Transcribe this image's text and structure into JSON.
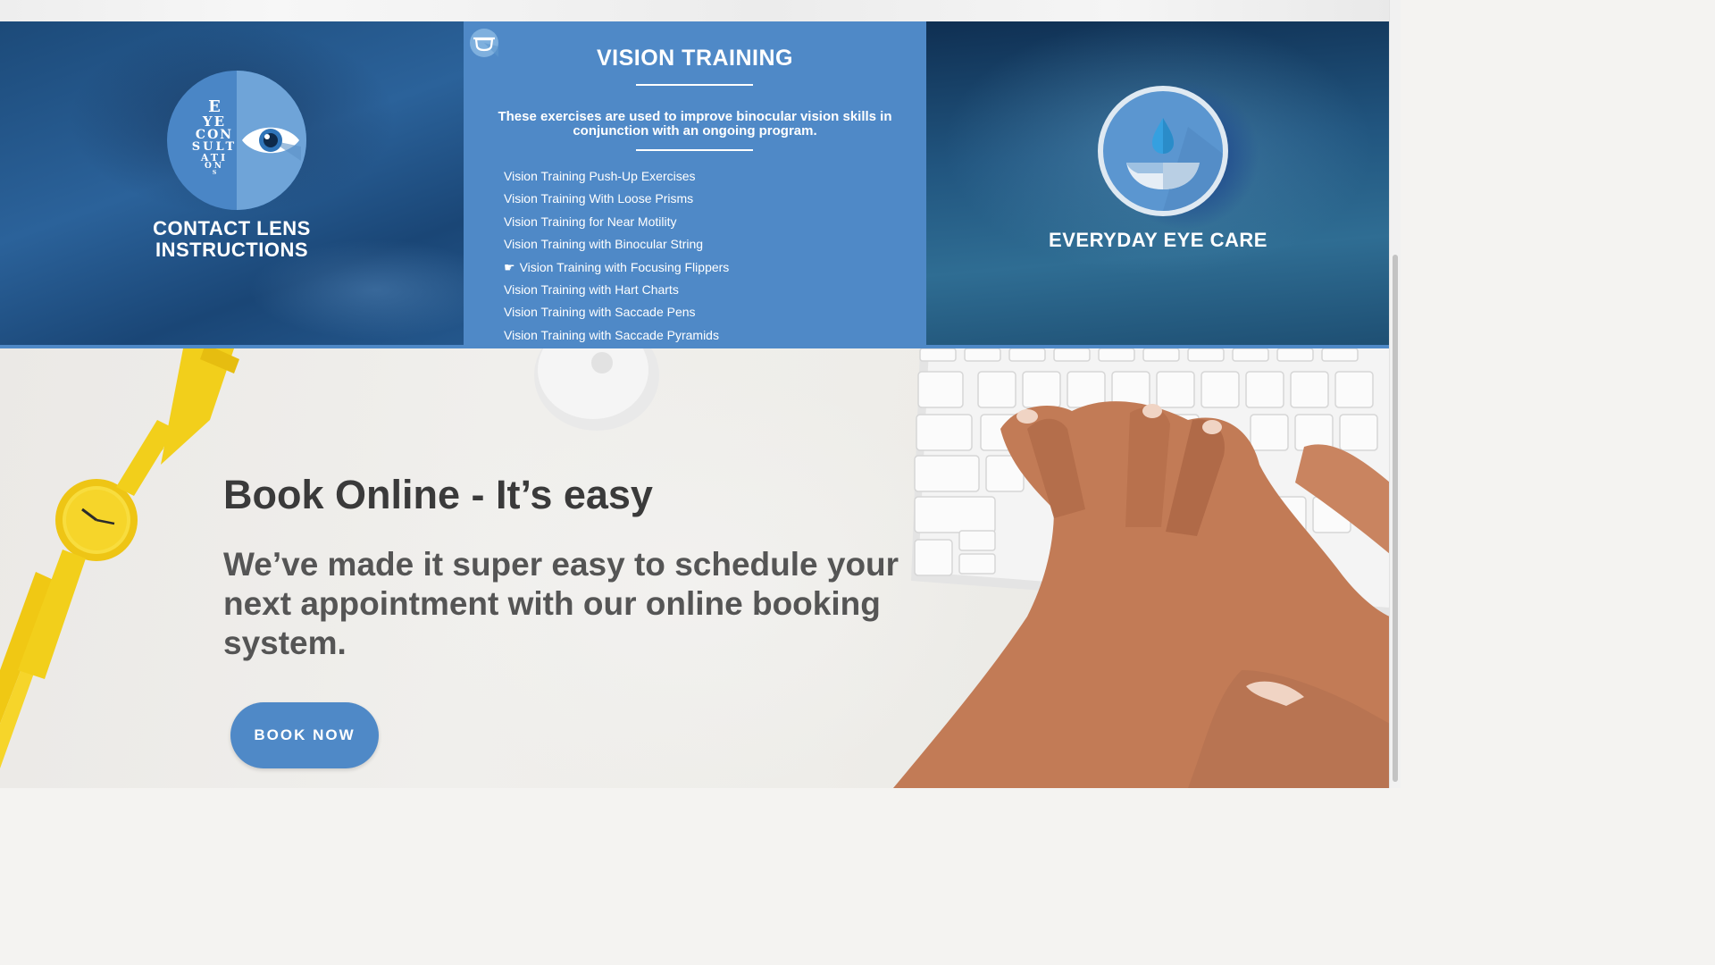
{
  "colors": {
    "accent": "#4f89c7",
    "heading_text": "#3a3a3a",
    "sub_text": "#555555",
    "white": "#ffffff"
  },
  "services": {
    "left": {
      "emblem_text_lines": [
        "E",
        "YE",
        "CON",
        "SULT",
        "ATI",
        "ON",
        "S"
      ],
      "title_line1": "CONTACT LENS",
      "title_line2": "INSTRUCTIONS",
      "icon": "eye-icon"
    },
    "middle": {
      "badge_icon": "glasses-icon",
      "title": "VISION TRAINING",
      "description": "These exercises are used to improve binocular vision skills in conjunction with an ongoing program.",
      "items": [
        {
          "label": "Vision Training Push-Up Exercises",
          "active": false
        },
        {
          "label": "Vision Training With Loose Prisms",
          "active": false
        },
        {
          "label": "Vision Training for Near Motility",
          "active": false
        },
        {
          "label": "Vision Training with Binocular String",
          "active": false
        },
        {
          "label": "Vision Training with Focusing Flippers",
          "active": true
        },
        {
          "label": "Vision Training with Hart Charts",
          "active": false
        },
        {
          "label": "Vision Training with Saccade Pens",
          "active": false
        },
        {
          "label": "Vision Training with Saccade Pyramids",
          "active": false
        }
      ],
      "pointer_glyph": "☛"
    },
    "right": {
      "title": "EVERYDAY EYE CARE",
      "icon": "eye-drop-icon"
    }
  },
  "booking": {
    "heading": "Book Online - It’s easy",
    "subheading": "We’ve made it super easy to schedule your next appointment with our online booking system.",
    "button_label": "BOOK NOW"
  }
}
